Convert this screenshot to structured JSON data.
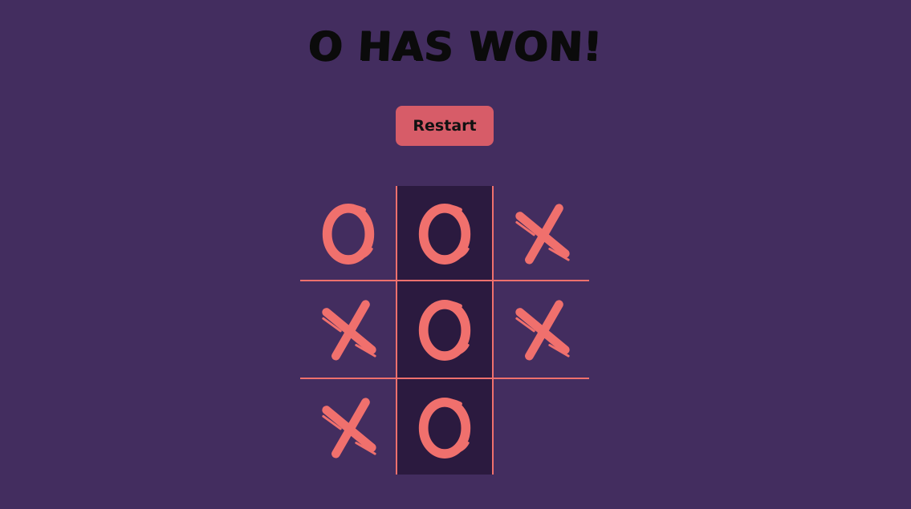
{
  "status": {
    "title": "O HAS WON!"
  },
  "controls": {
    "restart_label": "Restart"
  },
  "board": {
    "cells": [
      "O",
      "O",
      "X",
      "X",
      "O",
      "X",
      "X",
      "O",
      ""
    ],
    "winning_line": [
      1,
      4,
      7
    ]
  },
  "colors": {
    "background": "#432d5f",
    "mark": "#f0706d",
    "grid_line": "#f0706d",
    "win_cell": "#2b1a3f",
    "button": "#d75c68",
    "title": "#0b0b0b"
  },
  "icons": {
    "x_mark": "x-mark-icon",
    "o_mark": "o-mark-icon"
  }
}
